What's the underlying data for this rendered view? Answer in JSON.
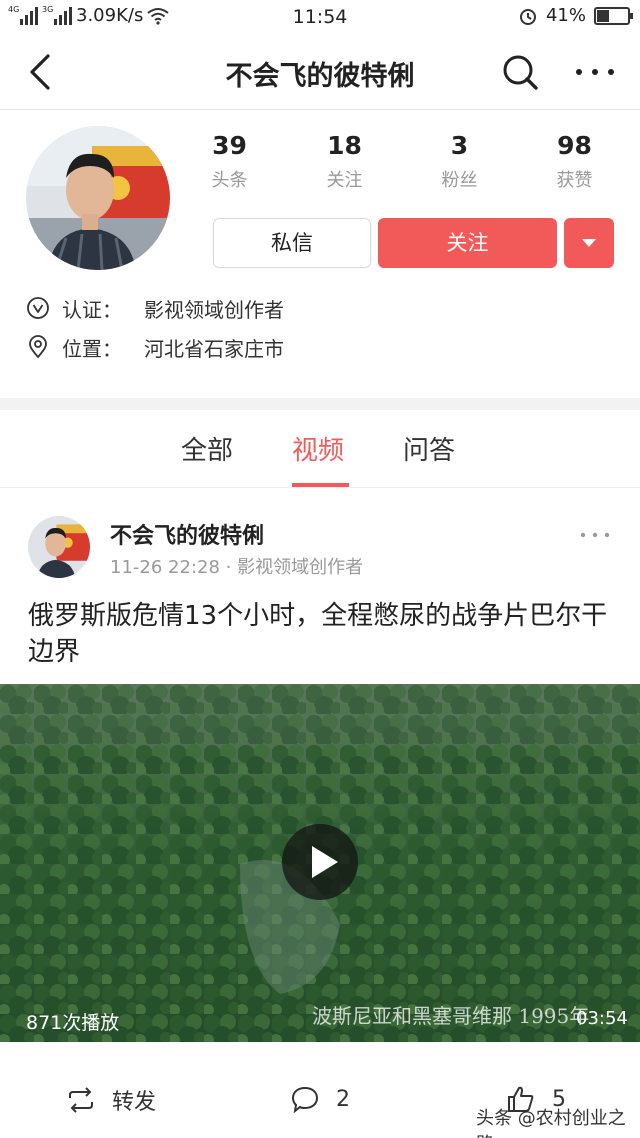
{
  "status_bar": {
    "signal1_tag": "4G",
    "signal2_tag": "3G",
    "speed": "3.09K/s",
    "time": "11:54",
    "battery": "41%",
    "battery_level": 0.41
  },
  "header": {
    "title": "不会飞的彼特俐",
    "back_icon": "back-icon",
    "search_icon": "search-icon",
    "more_icon": "more-icon"
  },
  "profile": {
    "stats": [
      {
        "value": "39",
        "label": "头条"
      },
      {
        "value": "18",
        "label": "关注"
      },
      {
        "value": "3",
        "label": "粉丝"
      },
      {
        "value": "98",
        "label": "获赞"
      }
    ],
    "message_button": "私信",
    "follow_button": "关注",
    "verify_label": "认证：",
    "verify_value": "影视领域创作者",
    "location_label": "位置：",
    "location_value": "河北省石家庄市"
  },
  "tabs": [
    {
      "label": "全部",
      "active": false
    },
    {
      "label": "视频",
      "active": true
    },
    {
      "label": "问答",
      "active": false
    }
  ],
  "post": {
    "author": "不会飞的彼特俐",
    "meta": "11-26 22:28 · 影视领域创作者",
    "title": "俄罗斯版危情13个小时，全程憋尿的战争片巴尔干边界",
    "plays": "871次播放",
    "caption": "波斯尼亚和黑塞哥维那 1995年",
    "duration": "03:54",
    "repost_label": "转发",
    "comment_count": "2",
    "like_count": "5"
  },
  "watermark": "头条 @农村创业之路",
  "colors": {
    "accent": "#f25a5a",
    "muted": "#999999"
  }
}
